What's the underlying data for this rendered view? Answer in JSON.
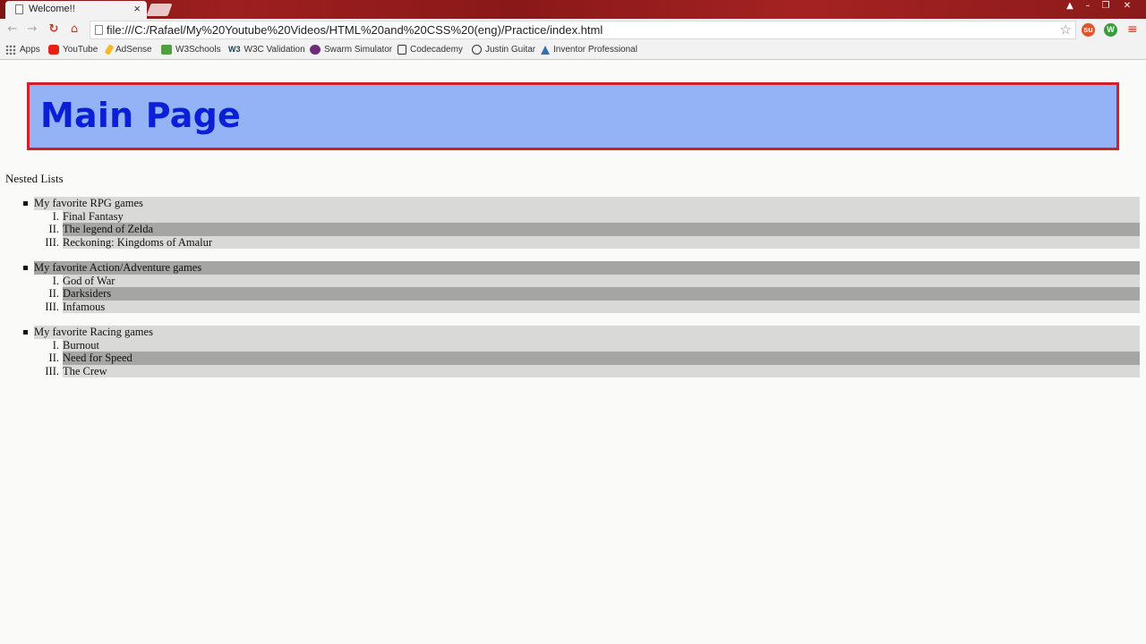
{
  "browser": {
    "tab_title": "Welcome!!",
    "tab_close": "×",
    "url": "file:///C:/Rafael/My%20Youtube%20Videos/HTML%20and%20CSS%20(eng)/Practice/index.html",
    "window_controls": [
      "▲",
      "–",
      "❐",
      "✕"
    ],
    "extensions": [
      "su",
      "W"
    ],
    "bookmarks": [
      {
        "label": "Apps",
        "icon": "apps-grid-icon"
      },
      {
        "label": "YouTube",
        "icon": "youtube-icon"
      },
      {
        "label": "AdSense",
        "icon": "adsense-icon"
      },
      {
        "label": "W3Schools",
        "icon": "w3schools-icon"
      },
      {
        "label": "W3C Validation",
        "icon": "w3c-icon"
      },
      {
        "label": "Swarm Simulator",
        "icon": "swarm-icon"
      },
      {
        "label": "Codecademy",
        "icon": "codecademy-icon"
      },
      {
        "label": "Justin Guitar",
        "icon": "justin-guitar-icon"
      },
      {
        "label": "Inventor Professional",
        "icon": "inventor-icon"
      }
    ]
  },
  "page": {
    "title": "Main Page",
    "section_label": "Nested Lists",
    "colors": {
      "header_bg": "#94b3f7",
      "header_border": "#d0202a",
      "title_text": "#0a1fd6",
      "row_light": "#d9dad7",
      "row_dark": "#a5a6a3"
    },
    "lists": [
      {
        "label": "My favorite RPG games",
        "items": [
          {
            "numeral": "I.",
            "text": "Final Fantasy"
          },
          {
            "numeral": "II.",
            "text": "The legend of Zelda"
          },
          {
            "numeral": "III.",
            "text": "Reckoning: Kingdoms of Amalur"
          }
        ]
      },
      {
        "label": "My favorite Action/Adventure games",
        "items": [
          {
            "numeral": "I.",
            "text": "God of War"
          },
          {
            "numeral": "II.",
            "text": "Darksiders"
          },
          {
            "numeral": "III.",
            "text": "Infamous"
          }
        ]
      },
      {
        "label": "My favorite Racing games",
        "items": [
          {
            "numeral": "I.",
            "text": "Burnout"
          },
          {
            "numeral": "II.",
            "text": "Need for Speed"
          },
          {
            "numeral": "III.",
            "text": "The Crew"
          }
        ]
      }
    ]
  }
}
